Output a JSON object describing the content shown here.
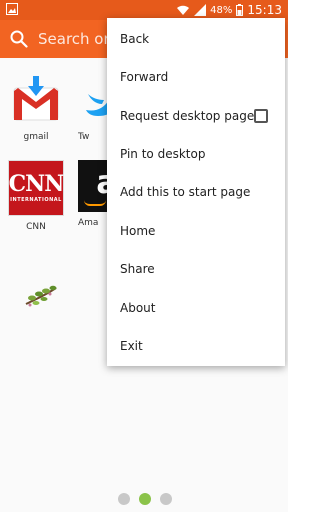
{
  "status_bar": {
    "battery": "48%",
    "time": "15:13",
    "icons": [
      "image-icon",
      "wifi-icon",
      "signal-icon",
      "battery-icon"
    ]
  },
  "search": {
    "placeholder": "Search or t"
  },
  "speed_dial": [
    {
      "label": "gmail",
      "icon": "gmail-icon"
    },
    {
      "label": "Tw",
      "icon": "twitter-icon"
    },
    {
      "label": "CNN",
      "icon": "cnn-icon"
    },
    {
      "label": "Ama",
      "icon": "amazon-icon"
    },
    {
      "label": "",
      "icon": "plant-icon"
    }
  ],
  "cnn_logo": {
    "big": "CNN",
    "small": "INTERNATIONAL"
  },
  "amazon_logo": {
    "letter": "a"
  },
  "menu": {
    "items": [
      {
        "label": "Back"
      },
      {
        "label": "Forward"
      },
      {
        "label": "Request desktop page",
        "checked": false
      },
      {
        "label": "Pin to desktop"
      },
      {
        "label": "Add this to start page"
      },
      {
        "label": "Home"
      },
      {
        "label": "Share"
      },
      {
        "label": "About"
      },
      {
        "label": "Exit"
      }
    ]
  },
  "pager": {
    "count": 3,
    "active_index": 1
  },
  "colors": {
    "accent": "#f26422",
    "status_bar": "#e65a1b",
    "active_dot": "#8bc34a",
    "inactive_dot": "#c8c8c8"
  }
}
